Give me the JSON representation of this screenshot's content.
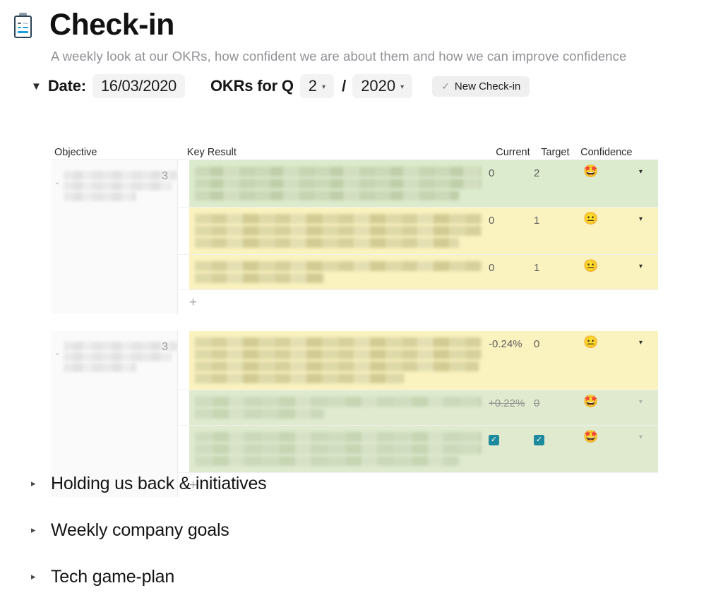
{
  "header": {
    "icon": "clipboard-icon",
    "title": "Check-in",
    "subtitle": "A weekly look at our OKRs, how confident we are about them and how we can improve confidence"
  },
  "controls": {
    "collapse_caret": "▼",
    "date_label": "Date:",
    "date_value": "16/03/2020",
    "okr_label": "OKRs for Q",
    "quarter_value": "2",
    "separator": "/",
    "year_value": "2020",
    "dropdown_caret": "▾",
    "new_checkin_button": "New Check-in",
    "new_checkin_check": "✓"
  },
  "table": {
    "columns": {
      "objective": "Objective",
      "key_result": "Key Result",
      "current": "Current",
      "target": "Target",
      "confidence": "Confidence"
    },
    "add_row_label": "+",
    "group_caret": "⌄",
    "row_caret": "▾",
    "groups": [
      {
        "objective_redacted_lines": 3,
        "count": "3",
        "rows": [
          {
            "text_lines": 3,
            "color": "green",
            "current": "0",
            "target": "2",
            "confidence_emoji": "🤩",
            "confidence_name": "star-struck",
            "current_struck": false,
            "current_is_checkbox": false,
            "target_is_checkbox": false,
            "caret_faded": false
          },
          {
            "text_lines": 3,
            "color": "yellow",
            "current": "0",
            "target": "1",
            "confidence_emoji": "😐",
            "confidence_name": "neutral-face",
            "current_struck": false,
            "current_is_checkbox": false,
            "target_is_checkbox": false,
            "caret_faded": false
          },
          {
            "text_lines": 2,
            "color": "yellow",
            "current": "0",
            "target": "1",
            "confidence_emoji": "😐",
            "confidence_name": "neutral-face",
            "current_struck": false,
            "current_is_checkbox": false,
            "target_is_checkbox": false,
            "caret_faded": false
          }
        ]
      },
      {
        "objective_redacted_lines": 3,
        "count": "3",
        "rows": [
          {
            "text_lines": 4,
            "color": "yellow",
            "current": "-0.24%",
            "target": "0",
            "confidence_emoji": "😐",
            "confidence_name": "neutral-face",
            "current_struck": false,
            "current_is_checkbox": false,
            "target_is_checkbox": false,
            "caret_faded": false
          },
          {
            "text_lines": 2,
            "color": "greenpale",
            "current": "+0.22%",
            "target": "0",
            "confidence_emoji": "🤩",
            "confidence_name": "star-struck",
            "current_struck": true,
            "current_is_checkbox": false,
            "target_is_checkbox": false,
            "caret_faded": true
          },
          {
            "text_lines": 3,
            "color": "greenpale",
            "current": "✓",
            "target": "✓",
            "confidence_emoji": "🤩",
            "confidence_name": "star-struck",
            "current_struck": false,
            "current_is_checkbox": true,
            "target_is_checkbox": true,
            "caret_faded": true
          }
        ]
      }
    ]
  },
  "sections": [
    {
      "caret": "▸",
      "title": "Holding us back & initiatives"
    },
    {
      "caret": "▸",
      "title": "Weekly company goals"
    },
    {
      "caret": "▸",
      "title": "Tech game-plan"
    }
  ]
}
